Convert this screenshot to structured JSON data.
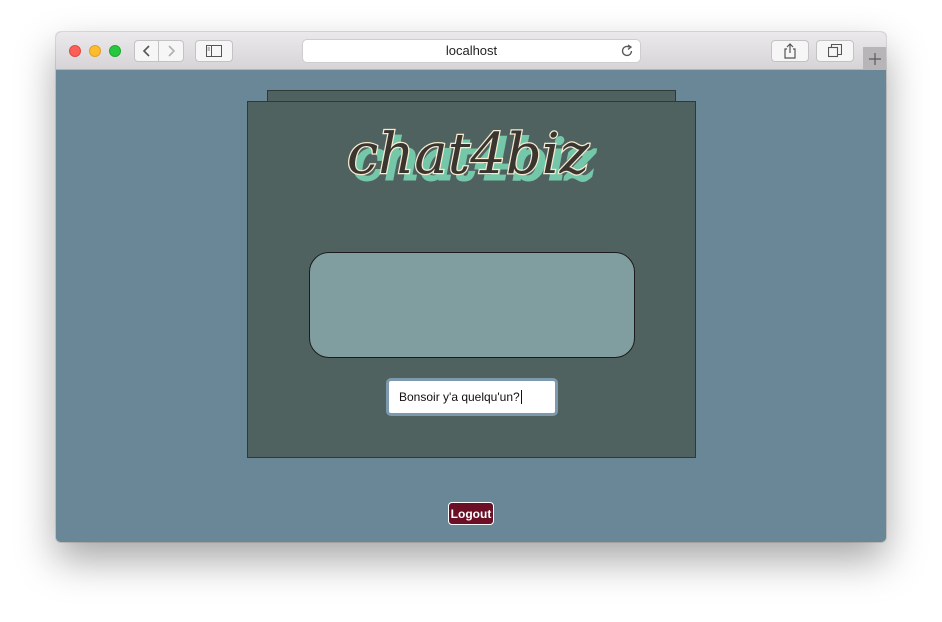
{
  "browser": {
    "url": "localhost",
    "icons": {
      "back": "chevron-left-icon",
      "forward": "chevron-right-icon",
      "sidebar": "sidebar-icon",
      "reload": "reload-icon",
      "share": "share-icon",
      "tabs": "tabs-icon",
      "new_tab": "plus-icon"
    }
  },
  "app": {
    "logo_text": "chat4biz",
    "message_input_value": "Bonsoir y'a quelqu'un?",
    "logout_label": "Logout"
  },
  "colors": {
    "page_background": "#6a8797",
    "panel": "#50625f",
    "message_area": "#809ea0",
    "logo_text": "#3a3531",
    "logo_shadow": "#74c7a9",
    "logo_outline": "#f4ebd0",
    "logout_button": "#6a0f26"
  }
}
